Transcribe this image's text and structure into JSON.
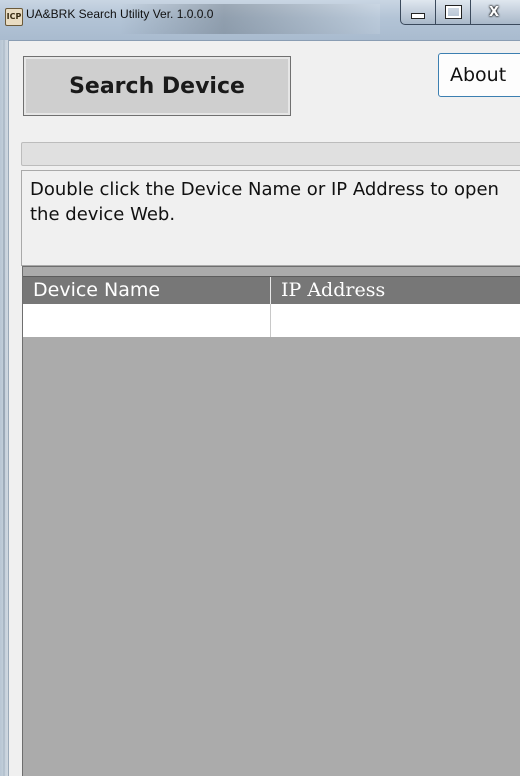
{
  "window": {
    "title": "UA&BRK Search Utility  Ver. 1.0.0.0",
    "icon_text": "ICP",
    "min_symbol": "",
    "max_symbol": "",
    "close_symbol": "X"
  },
  "toolbar": {
    "search_label": "Search Device",
    "about_label": "About"
  },
  "progress": {
    "value": 0
  },
  "info": {
    "text": "Double click the Device Name or IP Address to open the device Web."
  },
  "table": {
    "columns": [
      "Device Name",
      "IP Address"
    ],
    "rows": [
      [
        "",
        ""
      ]
    ]
  }
}
